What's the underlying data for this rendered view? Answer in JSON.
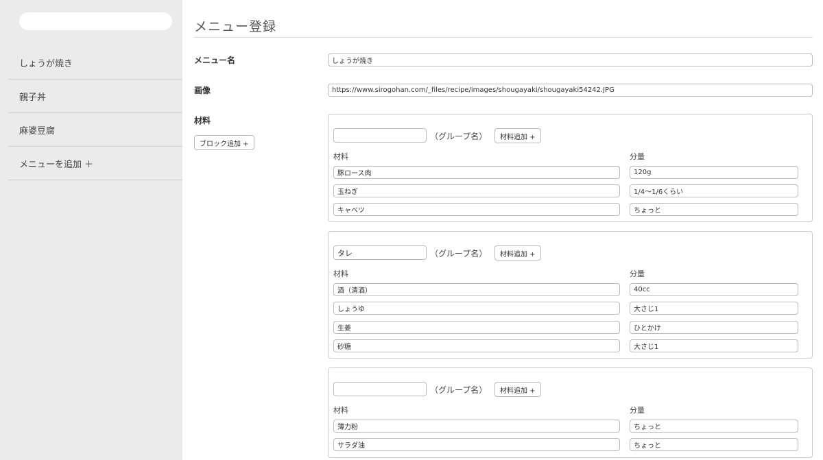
{
  "sidebar": {
    "search_placeholder": "",
    "items": [
      {
        "label": "しょうが焼き"
      },
      {
        "label": "親子丼"
      },
      {
        "label": "麻婆豆腐"
      },
      {
        "label": "メニューを追加 ＋"
      }
    ]
  },
  "main": {
    "title": "メニュー登録",
    "menu_name_label": "メニュー名",
    "menu_name_value": "しょうが焼き",
    "image_label": "画像",
    "image_value": "https://www.sirogohan.com/_files/recipe/images/shougayaki/shougayaki54242.JPG",
    "ingredients_label": "材料",
    "add_block_label": "ブロック追加 +",
    "group_name_label": "（グループ名）",
    "add_ingredient_label": "材料追加 +",
    "col_name_header": "材料",
    "col_qty_header": "分量",
    "blocks": [
      {
        "group": "",
        "rows": [
          {
            "name": "豚ロース肉",
            "qty": "120g"
          },
          {
            "name": "玉ねぎ",
            "qty": "1/4～1/6くらい"
          },
          {
            "name": "キャベツ",
            "qty": "ちょっと"
          }
        ]
      },
      {
        "group": "タレ",
        "rows": [
          {
            "name": "酒（清酒）",
            "qty": "40cc"
          },
          {
            "name": "しょうゆ",
            "qty": "大さじ1"
          },
          {
            "name": "生姜",
            "qty": "ひとかけ"
          },
          {
            "name": "砂糖",
            "qty": "大さじ1"
          }
        ]
      },
      {
        "group": "",
        "rows": [
          {
            "name": "薄力粉",
            "qty": "ちょっと"
          },
          {
            "name": "サラダ油",
            "qty": "ちょっと"
          }
        ]
      }
    ]
  }
}
